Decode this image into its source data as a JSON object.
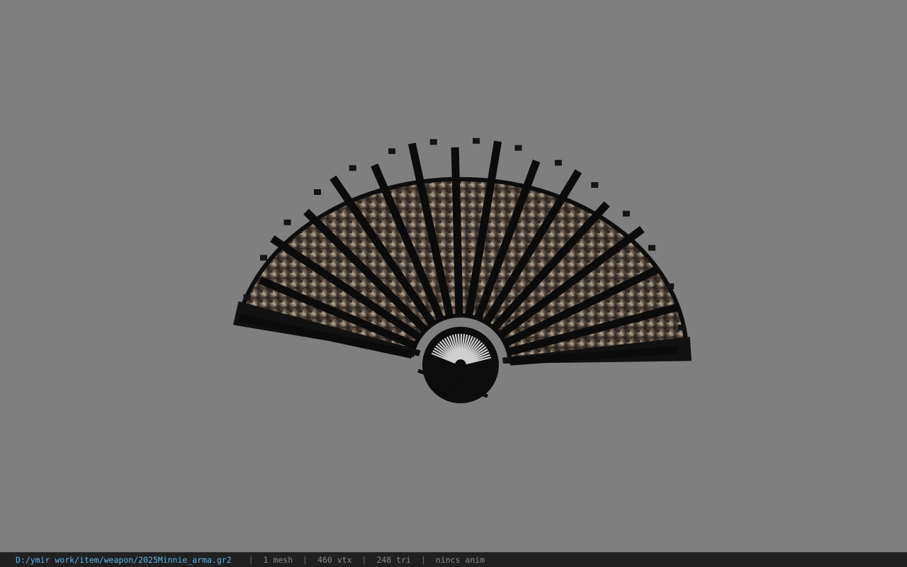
{
  "viewer": {
    "background_color": "#7f7f7f",
    "model_object": "folding-fan-weapon"
  },
  "statusbar": {
    "file_path": "D:/ymir work/item/weapon/2025Minnie_arma.gr2",
    "mesh_count": "1 mesh",
    "vertex_count": "460 vtx",
    "triangle_count": "248 tri",
    "animation_status": "nincs anim",
    "separator": "|",
    "path_color": "#5fb6e6"
  }
}
